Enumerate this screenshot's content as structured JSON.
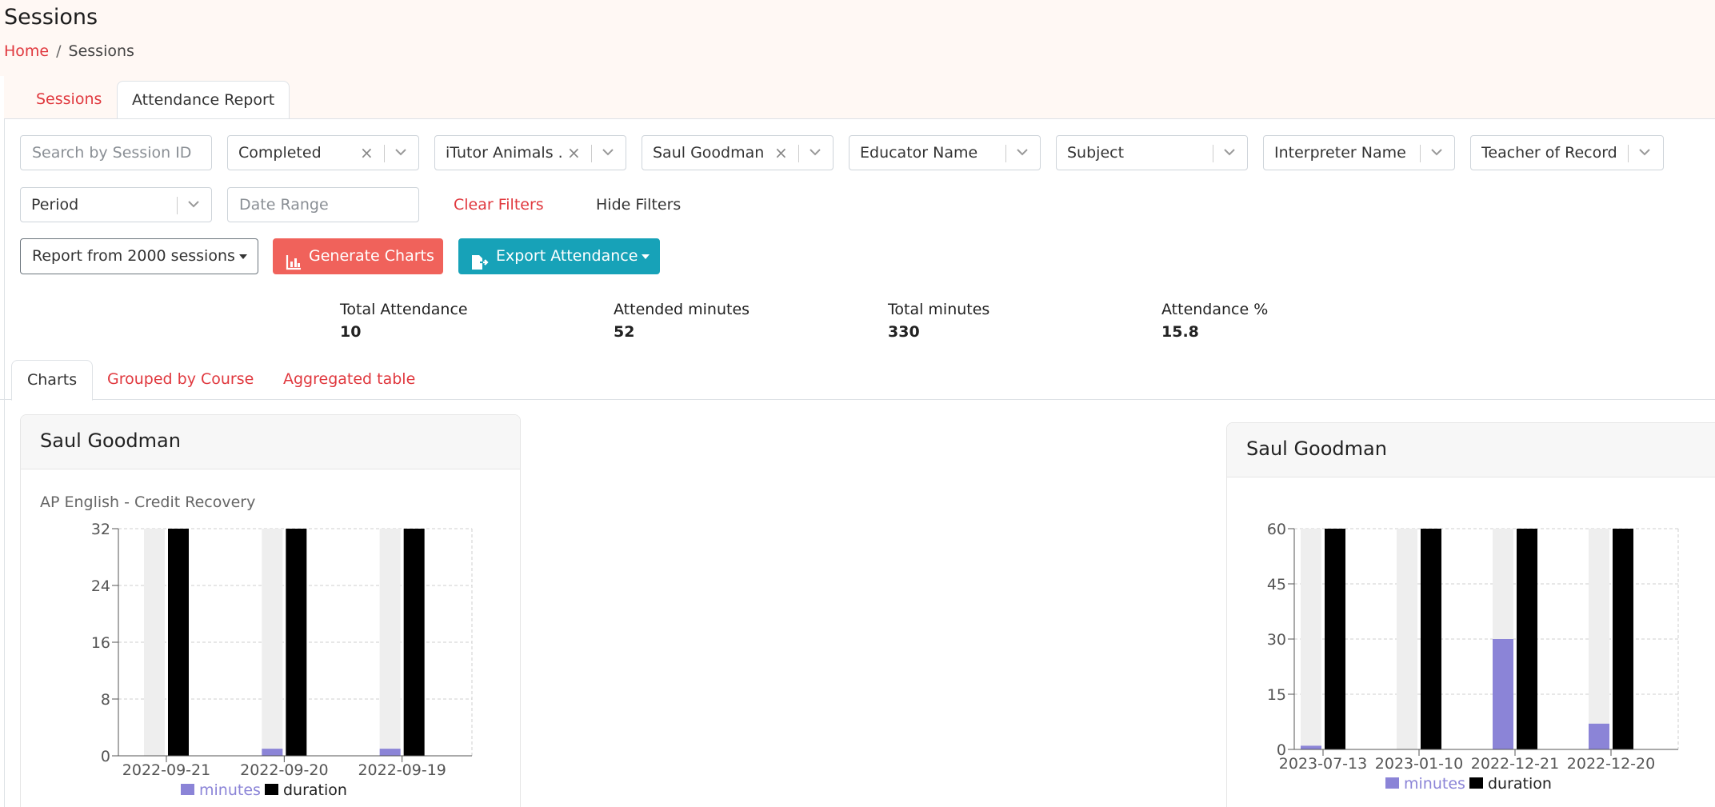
{
  "page": {
    "title": "Sessions",
    "breadcrumb": {
      "home": "Home",
      "current": "Sessions"
    }
  },
  "tabs": [
    {
      "label": "Sessions"
    },
    {
      "label": "Attendance Report"
    }
  ],
  "filters": {
    "search_placeholder": "Search by Session ID",
    "status": "Completed",
    "course": "iTutor Animals ...",
    "person": "Saul Goodman",
    "educator": "Educator Name",
    "subject": "Subject",
    "interpreter": "Interpreter Name",
    "teacher": "Teacher of Record",
    "period": "Period",
    "date_range_placeholder": "Date Range",
    "clear_label": "Clear Filters",
    "hide_label": "Hide Filters"
  },
  "actions": {
    "report_label": "Report from 2000 sessions",
    "generate_label": "Generate Charts",
    "export_label": "Export Attendance"
  },
  "stats": [
    {
      "label": "Total Attendance",
      "value": "10"
    },
    {
      "label": "Attended minutes",
      "value": "52"
    },
    {
      "label": "Total minutes",
      "value": "330"
    },
    {
      "label": "Attendance %",
      "value": "15.8"
    }
  ],
  "sub_tabs": [
    {
      "label": "Charts"
    },
    {
      "label": "Grouped by Course"
    },
    {
      "label": "Aggregated table"
    }
  ],
  "colors": {
    "accent": "#e0383e",
    "minutes": "#8b84d7",
    "duration": "#000000",
    "band": "#eeeeee"
  },
  "chart_data": [
    {
      "type": "bar",
      "title": "Saul Goodman",
      "subtitle": "AP English - Credit Recovery",
      "categories": [
        "2022-09-21",
        "2022-09-20",
        "2022-09-19"
      ],
      "series": [
        {
          "name": "minutes",
          "values": [
            0,
            1,
            1
          ]
        },
        {
          "name": "duration",
          "values": [
            34,
            34,
            34
          ]
        }
      ],
      "ylim": [
        0,
        32
      ],
      "yticks": [
        0,
        8,
        16,
        24,
        32
      ],
      "grid": true,
      "legend": "bottom"
    },
    {
      "type": "bar",
      "title": "Saul Goodman",
      "categories": [
        "2023-07-13",
        "2023-01-10",
        "2022-12-21",
        "2022-12-20"
      ],
      "series": [
        {
          "name": "minutes",
          "values": [
            1,
            0,
            30,
            7
          ]
        },
        {
          "name": "duration",
          "values": [
            60,
            60,
            60,
            60
          ]
        }
      ],
      "ylim": [
        0,
        60
      ],
      "yticks": [
        0,
        15,
        30,
        45,
        60
      ],
      "grid": true,
      "legend": "bottom"
    }
  ]
}
